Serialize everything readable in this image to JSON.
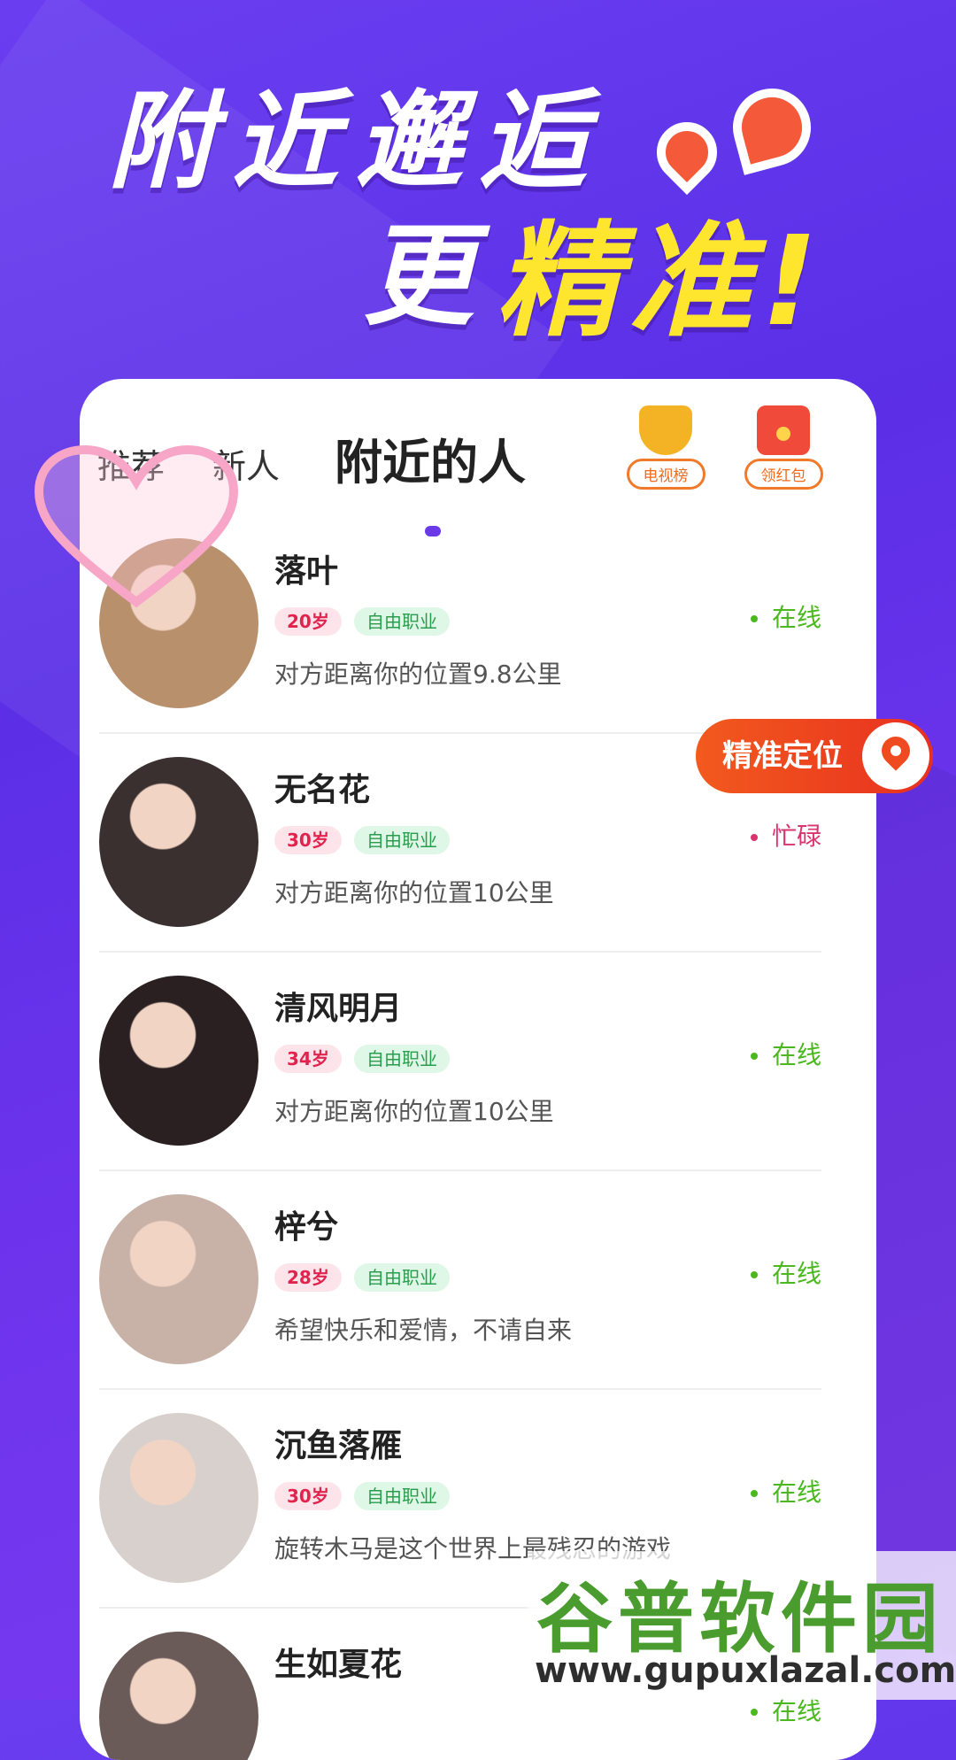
{
  "headline": {
    "line1": "附近邂逅",
    "line2_a": "更",
    "line2_b": "精准!"
  },
  "tabs": {
    "recommend": "推荐",
    "new": "新人",
    "nearby": "附近的人"
  },
  "top_buttons": {
    "tv_list": "电视榜",
    "red_packet": "领红包"
  },
  "floating": {
    "locate": "精准定位"
  },
  "people": [
    {
      "name": "落叶",
      "age": "20岁",
      "job": "自由职业",
      "desc": "对方距离你的位置9.8公里",
      "status": "在线",
      "status_type": "online",
      "avatar_color": "#b8906c"
    },
    {
      "name": "无名花",
      "age": "30岁",
      "job": "自由职业",
      "desc": "对方距离你的位置10公里",
      "status": "忙碌",
      "status_type": "busy",
      "avatar_color": "#3a3030"
    },
    {
      "name": "清风明月",
      "age": "34岁",
      "job": "自由职业",
      "desc": "对方距离你的位置10公里",
      "status": "在线",
      "status_type": "online",
      "avatar_color": "#2a2022"
    },
    {
      "name": "梓兮",
      "age": "28岁",
      "job": "自由职业",
      "desc": "希望快乐和爱情，不请自来",
      "status": "在线",
      "status_type": "online",
      "avatar_color": "#c8b2a8"
    },
    {
      "name": "沉鱼落雁",
      "age": "30岁",
      "job": "自由职业",
      "desc": "旋转木马是这个世界上最残忍的游戏",
      "status": "在线",
      "status_type": "online",
      "avatar_color": "#d8d0cc"
    },
    {
      "name": "生如夏花",
      "age": "",
      "job": "",
      "desc": "",
      "status": "在线",
      "status_type": "online",
      "avatar_color": "#6a5a58"
    }
  ],
  "watermark": {
    "title": "谷普软件园",
    "url": "www.gupuxlazal.com"
  }
}
